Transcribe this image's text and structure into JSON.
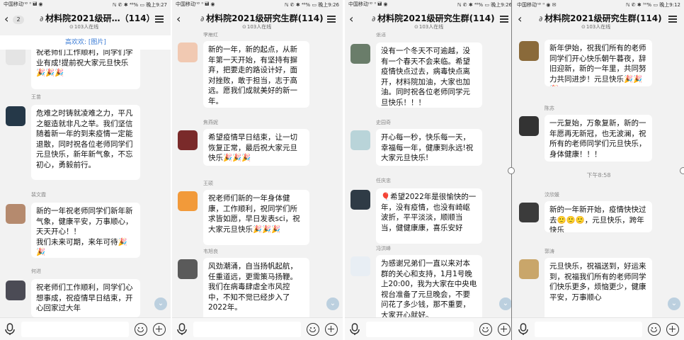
{
  "colors": {
    "background": "#f2f2f2",
    "bubble": "#ffffff",
    "accent_link": "#3a7bd5",
    "fab": "#bcd0df"
  },
  "screens": [
    {
      "status": {
        "carrier": "中国移动ⁿᴰ ᴵᴵ 🖬 ◉",
        "right": "ℕ ✆ ✱ ⁴⁸% ▭ 晚上9:27"
      },
      "back_badge": "2",
      "title": "材料院2021级研…（114）",
      "online": "103人在线",
      "notice": "高欢欢: [图片]",
      "timestamp": "",
      "messages": [
        {
          "sender": "",
          "text": "祝老师们工作顺利，同学们学业有成!提前祝大家元旦快乐🎉🎉🎉"
        },
        {
          "sender": "王苗",
          "text": "危难之时铸就凌难之力，平凡之躯造就非凡之举。我们坚信随着新一年的到来疫情一定能退散，同时祝各位老师同学们元旦快乐，新年新气象，不忘初心，勇毅前行。"
        },
        {
          "sender": "裴文霞",
          "text": "新的一年祝老师同学们新年新气象，健康平安，万事顺心，天天开心！！\n我们未来可期，来年可待🎉🎉"
        },
        {
          "sender": "何进",
          "text": "祝老师们工作顺利，同学们心想事成，祝疫情早日结束，开心回家过大年"
        }
      ]
    },
    {
      "status": {
        "carrier": "中国移动ⁿᴰ ᴵᴵ 🖬 ◉",
        "right": "ℕ ✆ ✱ ⁴⁸% ▭ 晚上9:26"
      },
      "back_badge": "",
      "title": "材料院2021级研究生群(114)",
      "online": "103人在线",
      "notice": "",
      "timestamp": "",
      "messages": [
        {
          "sender": "李雁红",
          "text": "新的一年，新的起点，从新年第一天开始，有坚持有摒弃，把要走的路设计好，面对挫败，敢于担当，志于高远。愿我们成就美好的新一年。"
        },
        {
          "sender": "焦燕妮",
          "text": "希望疫情早日结束，让一切恢复正常，最后祝大家元旦快乐🎉🎉🎉"
        },
        {
          "sender": "王硕",
          "text": "祝老师们新的一年身体健康，工作顺利，祝同学们所求皆如愿，早日发表sci，祝大家元旦快乐🎉🎉🎉"
        },
        {
          "sender": "韦旭良",
          "text": "    风劲潮涌，自当扬帆起航，任重道远，更需策马扬鞭。我们在病毒肆虐全市风控中，不知不觉已经步入了2022年。"
        }
      ]
    },
    {
      "status": {
        "carrier": "中国移动ⁿᴰ ᴵᴵ 🖬 ◉",
        "right": "ℕ ✆ ✱ ⁴⁸% ▭ 晚上9:26"
      },
      "back_badge": "",
      "title": "材料院2021级研究生群(114)",
      "online": "103人在线",
      "notice": "",
      "timestamp": "",
      "messages": [
        {
          "sender": "张洁",
          "text": "没有一个冬天不可逾越，没有一个春天不会来临。希望疫情快点过去，病毒快点离开，材料院加油，大家也加油。同时祝各位老师同学元旦快乐！！！"
        },
        {
          "sender": "史园奇",
          "text": "开心每一秒，快乐每一天，幸福每一年，健康到永远!祝大家元旦快乐!"
        },
        {
          "sender": "任庆忠",
          "text": "🎈希望2022年是很愉快的一年，没有疫情，也没有崎岖波折，平平淡淡，顺顺当当，健健康康，喜乐安好"
        },
        {
          "sender": "冯洪峰",
          "text": "为感谢兄弟们一直以来对本群的关心和支持，1月1号晚上20:00，我为大家在中央电视台准备了元旦晚会，不要问花了多少钱，那不重要，大家开心就好。"
        }
      ]
    },
    {
      "status": {
        "carrier": "中国移动ⁿᴰ ᴵᴵ ◉ ✉",
        "right": "ℕ ✆ ✱ ⁵⁰% ▭ 晚上9:12"
      },
      "back_badge": "",
      "title": "材料院2021级研究生群(114)",
      "online": "103人在线",
      "notice": "",
      "timestamp": "下午8:58",
      "messages": [
        {
          "sender": "",
          "text": "新年伊始，祝我们所有的老师同学们开心快乐朝午暮夜，辞旧迎新，新的一年里，共同努力共同进步！元旦快乐🎉🎉🎉"
        },
        {
          "sender": "陈苏",
          "text": "一元复始，万象复新，新的一年愿再无新冠，也无波澜，祝所有的老师同学们元旦快乐，身体健康！！！"
        },
        {
          "sender": "汶欣媛",
          "text": "新的一年新开始，疫情快快过去🙂🙂🙂，元旦快乐，跨年快乐"
        },
        {
          "sender": "郭涛",
          "text": "元旦快乐，祝福送到，好运来到，祝福我们所有的老师同学们快乐更多，烦恼更少，健康平安，万事顺心"
        }
      ]
    }
  ],
  "avatars": [
    [
      "#e4e4e4",
      "#253848",
      "#b58a6e",
      "#4b4b55"
    ],
    [
      "#f1c9b2",
      "#7a2a2a",
      "#f29a3a",
      "#5a5a5a"
    ],
    [
      "#6a7d6a",
      "#b9d4d9",
      "#2f3b46",
      "#e8eef4"
    ],
    [
      "#8a6a3a",
      "#333333",
      "#3b3b3b",
      "#c9a66a"
    ]
  ]
}
